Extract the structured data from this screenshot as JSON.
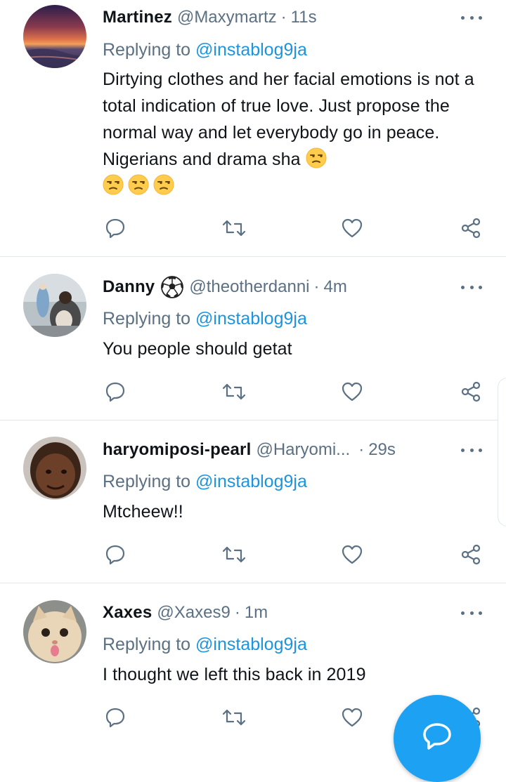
{
  "tweets": [
    {
      "name": "Martinez",
      "handle": "@Maxymartz",
      "time": "11s",
      "replying_prefix": "Replying to",
      "replying_to": "@instablog9ja",
      "text": "Dirtying clothes and her facial emotions is not a total indication of true love. Just propose the normal way and let everybody go in peace. Nigerians and drama sha",
      "emojis": [
        "unamused-face",
        "unamused-face",
        "unamused-face",
        "unamused-face"
      ]
    },
    {
      "name": "Danny",
      "name_emoji": "soccer-ball",
      "handle": "@theotherdanni",
      "time": "4m",
      "replying_prefix": "Replying to",
      "replying_to": "@instablog9ja",
      "text": "You people should getat"
    },
    {
      "name": "haryomiposi-pearl",
      "handle": "@Haryomi...",
      "time": "29s",
      "replying_prefix": "Replying to",
      "replying_to": "@instablog9ja",
      "text": "Mtcheew!!"
    },
    {
      "name": "Xaxes",
      "handle": "@Xaxes9",
      "time": "1m",
      "replying_prefix": "Replying to",
      "replying_to": "@instablog9ja",
      "text": "I thought we left this back in 2019"
    }
  ],
  "separator": "·",
  "icons": {
    "reply": "reply-icon",
    "retweet": "retweet-icon",
    "like": "heart-icon",
    "share": "share-icon",
    "more": "more-icon",
    "compose": "compose-icon"
  },
  "colors": {
    "accent": "#1da1f2",
    "mention": "#1b95e0",
    "secondary_text": "#5b7083",
    "divider": "#e1e8ed"
  }
}
